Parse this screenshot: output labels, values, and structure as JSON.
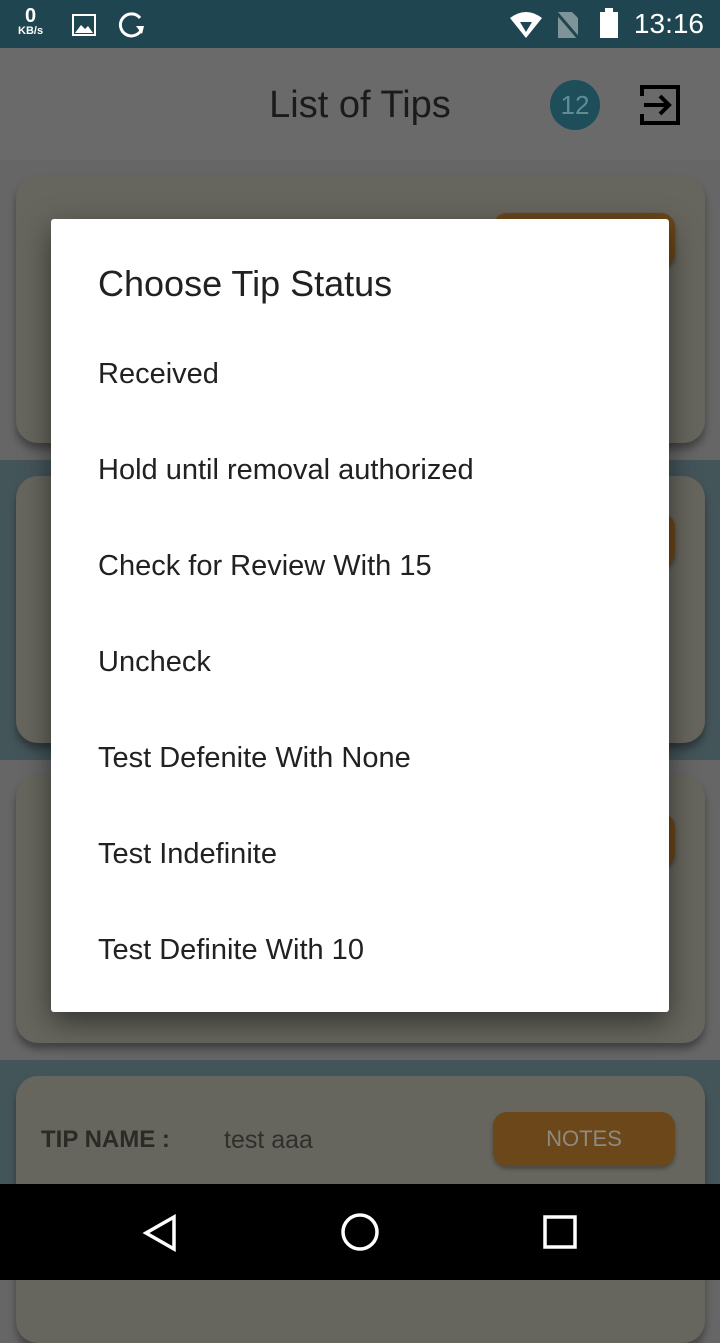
{
  "status_bar": {
    "net_speed": "0",
    "net_unit": "KB/s",
    "time": "13:16"
  },
  "header": {
    "title": "List of Tips",
    "count": "12"
  },
  "tips": [
    {
      "label": "TIP NAME :",
      "name": "test aaa",
      "notes_label": "NOTES"
    }
  ],
  "dialog": {
    "title": "Choose Tip Status",
    "options": [
      "Received",
      "Hold until removal authorized",
      "Check for Review With 15",
      "Uncheck",
      "Test Defenite With None",
      "Test Indefinite",
      "Test Definite With 10"
    ]
  },
  "colors": {
    "status_bar": "#1f4650",
    "accent": "#e0952f",
    "badge": "#2f7f8f"
  }
}
